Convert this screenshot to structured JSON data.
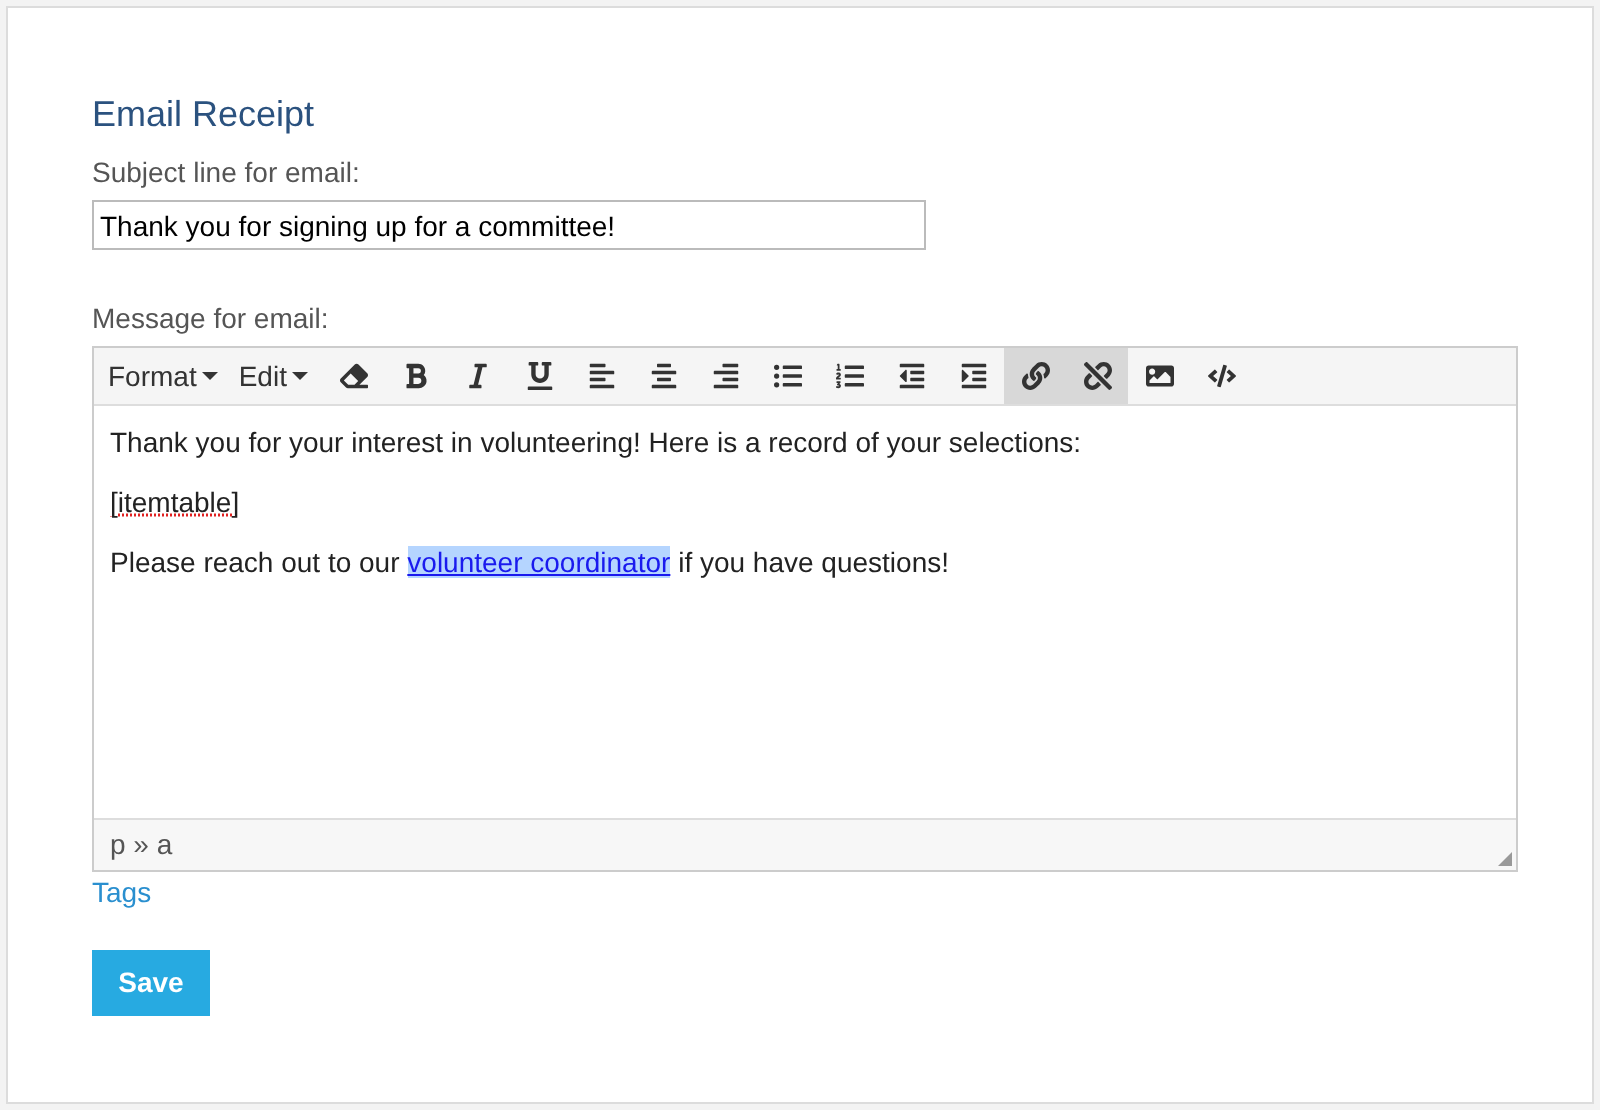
{
  "title": "Email Receipt",
  "subject": {
    "label": "Subject line for email:",
    "value": "Thank you for signing up for a committee!"
  },
  "message": {
    "label": "Message for email:",
    "menus": [
      "Format",
      "Edit"
    ],
    "tools": [
      {
        "kind": "eraser",
        "active": false
      },
      {
        "kind": "bold",
        "active": false
      },
      {
        "kind": "italic",
        "active": false
      },
      {
        "kind": "underline",
        "active": false
      },
      {
        "kind": "align-left",
        "active": false
      },
      {
        "kind": "align-center",
        "active": false
      },
      {
        "kind": "align-right",
        "active": false
      },
      {
        "kind": "bullet-list",
        "active": false
      },
      {
        "kind": "numbered-list",
        "active": false
      },
      {
        "kind": "outdent",
        "active": false
      },
      {
        "kind": "indent",
        "active": false
      },
      {
        "kind": "link",
        "active": true
      },
      {
        "kind": "unlink",
        "active": true
      },
      {
        "kind": "image",
        "active": false
      },
      {
        "kind": "code",
        "active": false
      }
    ],
    "paragraphs": [
      {
        "text": "Thank you for your interest in volunteering! Here is a record of your selections:",
        "misspelled": false
      },
      {
        "text": "[itemtable]",
        "misspelled": true
      },
      {
        "text": "Please reach out to our ",
        "link": "volunteer coordinator",
        "link_selected": true,
        "after": " if you have questions!",
        "misspelled": false
      }
    ],
    "path": "p » a"
  },
  "tags_link": "Tags",
  "save": "Save"
}
